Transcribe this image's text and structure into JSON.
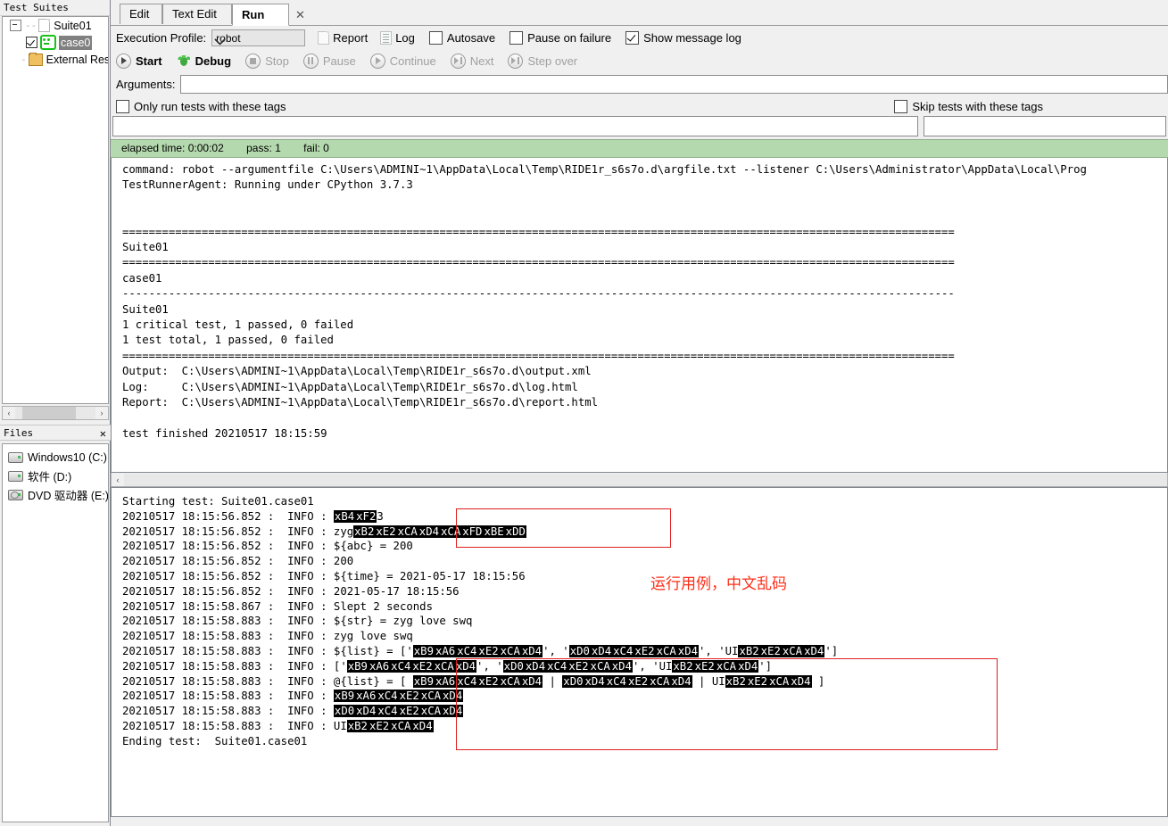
{
  "left_panel": {
    "tree_title": "Test Suites",
    "tree": {
      "suite_label": "Suite01",
      "case_label": "case0",
      "external_label": "External Res"
    },
    "files_title": "Files",
    "files_close": "✕",
    "drives": [
      {
        "label": "Windows10 (C:)",
        "icon": "hard-drive-icon"
      },
      {
        "label": "软件 (D:)",
        "icon": "hard-drive-icon"
      },
      {
        "label": "DVD 驱动器 (E:)",
        "icon": "dvd-drive-icon"
      }
    ],
    "scroll_left": "‹",
    "scroll_right": "›"
  },
  "tabs": [
    {
      "label": "Edit",
      "active": false
    },
    {
      "label": "Text Edit",
      "active": false
    },
    {
      "label": "Run",
      "active": true,
      "close": "✕"
    }
  ],
  "run_panel": {
    "execution_profile_label": "Execution Profile:",
    "execution_profile_value": "robot",
    "report_label": "Report",
    "log_label": "Log",
    "autosave_label": "Autosave",
    "autosave_checked": false,
    "pause_on_failure_label": "Pause on failure",
    "pause_on_failure_checked": false,
    "show_message_log_label": "Show message log",
    "show_message_log_checked": true,
    "controls": [
      {
        "label": "Start",
        "enabled": true
      },
      {
        "label": "Debug",
        "enabled": true
      },
      {
        "label": "Stop",
        "enabled": false
      },
      {
        "label": "Pause",
        "enabled": false
      },
      {
        "label": "Continue",
        "enabled": false
      },
      {
        "label": "Next",
        "enabled": false
      },
      {
        "label": "Step over",
        "enabled": false
      }
    ],
    "arguments_label": "Arguments:",
    "arguments_value": "",
    "only_run_tags_label": "Only run tests with these tags",
    "only_run_tags_checked": false,
    "skip_tags_label": "Skip tests with these tags",
    "skip_tags_checked": false,
    "only_run_tags_value": "",
    "skip_tags_value": ""
  },
  "status": {
    "elapsed": "elapsed time: 0:00:02",
    "pass": "pass: 1",
    "fail": "fail: 0",
    "bg_color": "#b5d9ae"
  },
  "console": {
    "text": "command: robot --argumentfile C:\\Users\\ADMINI~1\\AppData\\Local\\Temp\\RIDE1r_s6s7o.d\\argfile.txt --listener C:\\Users\\Administrator\\AppData\\Local\\Prog\nTestRunnerAgent: Running under CPython 3.7.3\n\n\n==============================================================================================================================\nSuite01\n==============================================================================================================================\ncase01\n------------------------------------------------------------------------------------------------------------------------------\nSuite01\n1 critical test, 1 passed, 0 failed\n1 test total, 1 passed, 0 failed\n==============================================================================================================================\nOutput:  C:\\Users\\ADMINI~1\\AppData\\Local\\Temp\\RIDE1r_s6s7o.d\\output.xml\nLog:     C:\\Users\\ADMINI~1\\AppData\\Local\\Temp\\RIDE1r_s6s7o.d\\log.html\nReport:  C:\\Users\\ADMINI~1\\AppData\\Local\\Temp\\RIDE1r_s6s7o.d\\report.html\n\ntest finished 20210517 18:15:59"
  },
  "message_log": {
    "lines": [
      {
        "prefix": "Starting test: Suite01.case01",
        "segments": []
      },
      {
        "prefix": "20210517 18:15:56.852 :  INFO : ",
        "segments": [
          {
            "esc": "xB4"
          },
          {
            "esc": "xF2"
          },
          {
            "t": "3"
          }
        ]
      },
      {
        "prefix": "20210517 18:15:56.852 :  INFO : ",
        "segments": [
          {
            "t": "zyg"
          },
          {
            "esc": "xB2"
          },
          {
            "esc": "xE2"
          },
          {
            "esc": "xCA"
          },
          {
            "esc": "xD4"
          },
          {
            "esc": "xCA"
          },
          {
            "esc": "xFD"
          },
          {
            "esc": "xBE"
          },
          {
            "esc": "xDD"
          }
        ]
      },
      {
        "prefix": "20210517 18:15:56.852 :  INFO : ",
        "segments": [
          {
            "t": "${abc} = 200"
          }
        ]
      },
      {
        "prefix": "20210517 18:15:56.852 :  INFO : ",
        "segments": [
          {
            "t": "200"
          }
        ]
      },
      {
        "prefix": "20210517 18:15:56.852 :  INFO : ",
        "segments": [
          {
            "t": "${time} = 2021-05-17 18:15:56"
          }
        ]
      },
      {
        "prefix": "20210517 18:15:56.852 :  INFO : ",
        "segments": [
          {
            "t": "2021-05-17 18:15:56"
          }
        ]
      },
      {
        "prefix": "20210517 18:15:58.867 :  INFO : ",
        "segments": [
          {
            "t": "Slept 2 seconds"
          }
        ]
      },
      {
        "prefix": "20210517 18:15:58.883 :  INFO : ",
        "segments": [
          {
            "t": "${str} = zyg love swq"
          }
        ]
      },
      {
        "prefix": "20210517 18:15:58.883 :  INFO : ",
        "segments": [
          {
            "t": "zyg love swq"
          }
        ]
      },
      {
        "prefix": "20210517 18:15:58.883 :  INFO : ",
        "segments": [
          {
            "t": "${list} = ['"
          },
          {
            "esc": "xB9"
          },
          {
            "esc": "xA6"
          },
          {
            "esc": "xC4"
          },
          {
            "esc": "xE2"
          },
          {
            "esc": "xCA"
          },
          {
            "esc": "xD4"
          },
          {
            "t": "', '"
          },
          {
            "esc": "xD0"
          },
          {
            "esc": "xD4"
          },
          {
            "esc": "xC4"
          },
          {
            "esc": "xE2"
          },
          {
            "esc": "xCA"
          },
          {
            "esc": "xD4"
          },
          {
            "t": "', 'UI"
          },
          {
            "esc": "xB2"
          },
          {
            "esc": "xE2"
          },
          {
            "esc": "xCA"
          },
          {
            "esc": "xD4"
          },
          {
            "t": "']"
          }
        ]
      },
      {
        "prefix": "20210517 18:15:58.883 :  INFO : ",
        "segments": [
          {
            "t": "['"
          },
          {
            "esc": "xB9"
          },
          {
            "esc": "xA6"
          },
          {
            "esc": "xC4"
          },
          {
            "esc": "xE2"
          },
          {
            "esc": "xCA"
          },
          {
            "esc": "xD4"
          },
          {
            "t": "', '"
          },
          {
            "esc": "xD0"
          },
          {
            "esc": "xD4"
          },
          {
            "esc": "xC4"
          },
          {
            "esc": "xE2"
          },
          {
            "esc": "xCA"
          },
          {
            "esc": "xD4"
          },
          {
            "t": "', 'UI"
          },
          {
            "esc": "xB2"
          },
          {
            "esc": "xE2"
          },
          {
            "esc": "xCA"
          },
          {
            "esc": "xD4"
          },
          {
            "t": "']"
          }
        ]
      },
      {
        "prefix": "20210517 18:15:58.883 :  INFO : ",
        "segments": [
          {
            "t": "@{list} = [ "
          },
          {
            "esc": "xB9"
          },
          {
            "esc": "xA6"
          },
          {
            "esc": "xC4"
          },
          {
            "esc": "xE2"
          },
          {
            "esc": "xCA"
          },
          {
            "esc": "xD4"
          },
          {
            "t": " | "
          },
          {
            "esc": "xD0"
          },
          {
            "esc": "xD4"
          },
          {
            "esc": "xC4"
          },
          {
            "esc": "xE2"
          },
          {
            "esc": "xCA"
          },
          {
            "esc": "xD4"
          },
          {
            "t": " | UI"
          },
          {
            "esc": "xB2"
          },
          {
            "esc": "xE2"
          },
          {
            "esc": "xCA"
          },
          {
            "esc": "xD4"
          },
          {
            "t": " ]"
          }
        ]
      },
      {
        "prefix": "20210517 18:15:58.883 :  INFO : ",
        "segments": [
          {
            "esc": "xB9"
          },
          {
            "esc": "xA6"
          },
          {
            "esc": "xC4"
          },
          {
            "esc": "xE2"
          },
          {
            "esc": "xCA"
          },
          {
            "esc": "xD4"
          }
        ]
      },
      {
        "prefix": "20210517 18:15:58.883 :  INFO : ",
        "segments": [
          {
            "esc": "xD0"
          },
          {
            "esc": "xD4"
          },
          {
            "esc": "xC4"
          },
          {
            "esc": "xE2"
          },
          {
            "esc": "xCA"
          },
          {
            "esc": "xD4"
          }
        ]
      },
      {
        "prefix": "20210517 18:15:58.883 :  INFO : ",
        "segments": [
          {
            "t": "UI"
          },
          {
            "esc": "xB2"
          },
          {
            "esc": "xE2"
          },
          {
            "esc": "xCA"
          },
          {
            "esc": "xD4"
          }
        ]
      },
      {
        "prefix": "Ending test:  Suite01.case01",
        "segments": []
      }
    ]
  },
  "annotation": {
    "text": "运行用例，中文乱码",
    "color": "#ff2d17"
  }
}
